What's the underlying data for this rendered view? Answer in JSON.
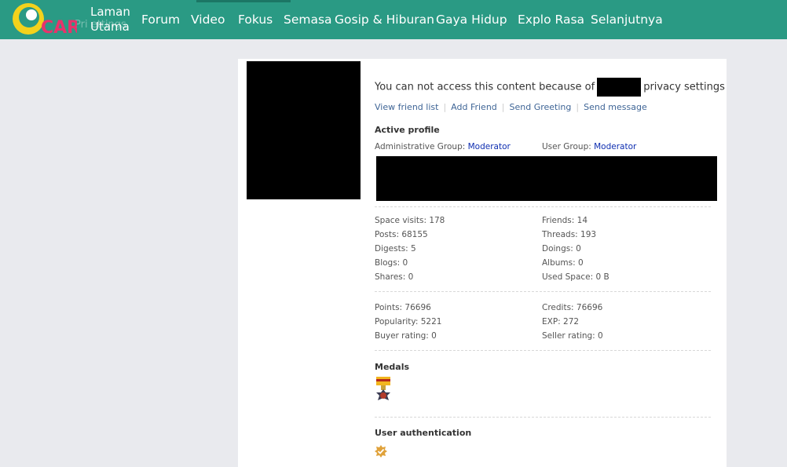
{
  "nav": {
    "logo_label": "CARI",
    "home_label": "Laman Utama",
    "items": [
      "Forum",
      "Video",
      "Fokus",
      "Semasa",
      "Gosip & Hiburan",
      "Gaya Hidup",
      "Explo Rasa",
      "Selanjutnya"
    ],
    "ghost_text": "Pri      ettings"
  },
  "profile": {
    "privacy_before": "You can not access this content because of",
    "privacy_after": "privacy settings",
    "actions": [
      "View friend list",
      "Add Friend",
      "Send Greeting",
      "Send message"
    ],
    "active_profile_title": "Active profile",
    "admin_group_label": "Administrative Group:",
    "admin_group_value": "Moderator",
    "user_group_label": "User Group:",
    "user_group_value": "Moderator",
    "stats_left": [
      "Space visits: 178",
      "Posts: 68155",
      "Digests: 5",
      "Blogs: 0",
      "Shares: 0"
    ],
    "stats_right": [
      "Friends: 14",
      "Threads: 193",
      "Doings: 0",
      "Albums: 0",
      "Used Space: 0 B"
    ],
    "points_left": [
      "Points: 76696",
      "Popularity: 5221",
      "Buyer rating: 0"
    ],
    "points_right": [
      "Credits: 76696",
      "EXP: 272",
      "Seller rating: 0"
    ],
    "medals_title": "Medals",
    "auth_title": "User authentication"
  },
  "colors": {
    "nav_bg": "#2a9a84",
    "page_bg": "#e9eaee",
    "link": "#3f6596",
    "group_link": "#0d2db0"
  }
}
